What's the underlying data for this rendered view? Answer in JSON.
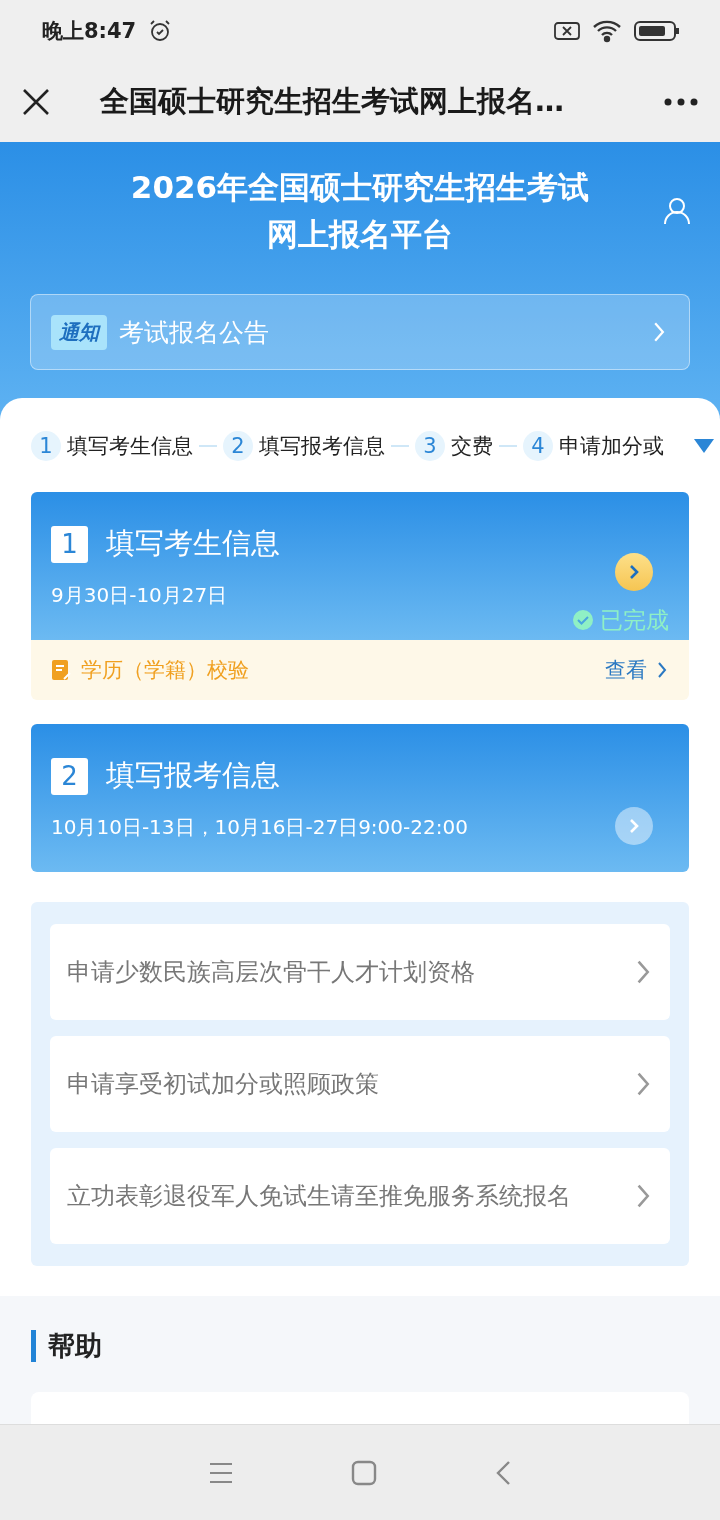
{
  "status_bar": {
    "time": "晚上8:47"
  },
  "title_bar": {
    "title": "全国硕士研究生招生考试网上报名…"
  },
  "header": {
    "title_lines": [
      "2026年全国硕士研究生招生考试",
      "网上报名平台"
    ]
  },
  "notice": {
    "tag": "通知",
    "text": "考试报名公告"
  },
  "steps": [
    {
      "number": "1",
      "label": "填写考生信息"
    },
    {
      "number": "2",
      "label": "填写报考信息"
    },
    {
      "number": "3",
      "label": "交费"
    },
    {
      "number": "4",
      "label": "申请加分或"
    }
  ],
  "stage_cards": [
    {
      "number": "1",
      "title": "填写考生信息",
      "dates": "9月30日-10月27日",
      "enabled": true,
      "status": "已完成",
      "sub_row": {
        "text": "学历（学籍）校验",
        "link": "查看"
      }
    },
    {
      "number": "2",
      "title": "填写报考信息",
      "dates": "10月10日-13日，10月16日-27日9:00-22:00",
      "enabled": false
    }
  ],
  "extra_links": [
    "申请少数民族高层次骨干人才计划资格",
    "申请享受初试加分或照顾政策",
    "立功表彰退役军人免试生请至推免服务系统报名"
  ],
  "help": {
    "title": "帮助"
  }
}
